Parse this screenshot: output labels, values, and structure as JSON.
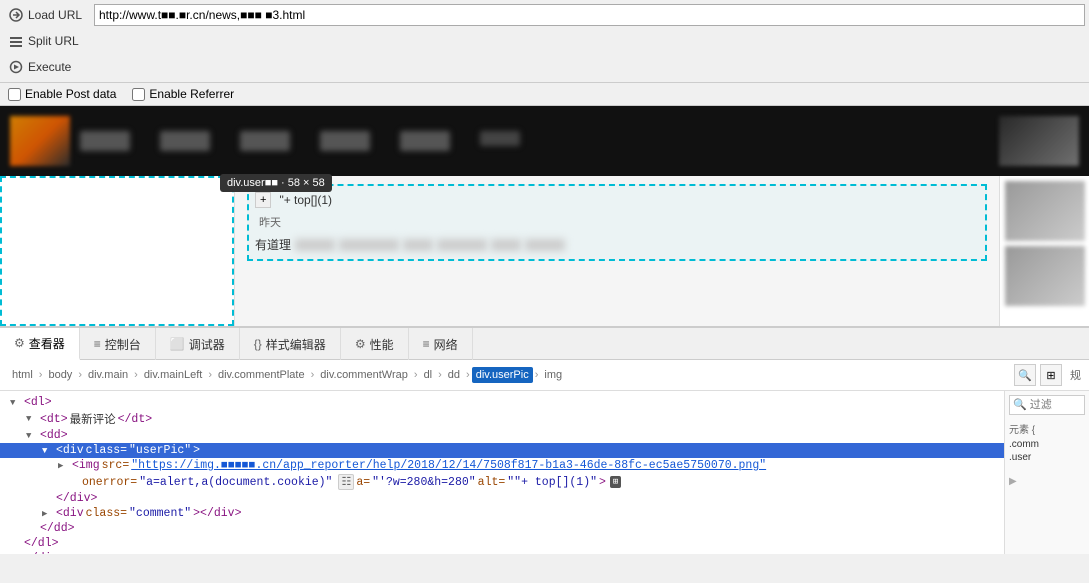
{
  "toolbar": {
    "load_url_label": "Load URL",
    "split_url_label": "Split URL",
    "execute_label": "Execute",
    "url_value": "http://www.t■■.■r.cn/news,■■■ ■3.html"
  },
  "checkboxes": {
    "post_data_label": "Enable Post data",
    "referrer_label": "Enable Referrer"
  },
  "breadcrumb": {
    "items": [
      "html",
      "body",
      "div.main",
      "div.mainLeft",
      "div.commentPlate",
      "div.commentWrap",
      "dl",
      "dd",
      "div.userPic",
      "img"
    ]
  },
  "devtools": {
    "tabs": [
      {
        "id": "inspector",
        "icon": "⚙",
        "label": "查看器"
      },
      {
        "id": "console",
        "icon": "≡",
        "label": "控制台"
      },
      {
        "id": "debugger",
        "icon": "⬛",
        "label": "调试器"
      },
      {
        "id": "style-editor",
        "icon": "{}",
        "label": "样式编辑器"
      },
      {
        "id": "performance",
        "icon": "⚙",
        "label": "性能"
      },
      {
        "id": "network",
        "icon": "≡",
        "label": "网络"
      }
    ]
  },
  "html_tree": {
    "lines": [
      {
        "indent": 0,
        "has_triangle": true,
        "triangle_open": true,
        "content": "<dl>"
      },
      {
        "indent": 1,
        "has_triangle": true,
        "triangle_open": true,
        "content": "<dt>最新评论</dt>"
      },
      {
        "indent": 1,
        "has_triangle": true,
        "triangle_open": true,
        "content": "<dd>"
      },
      {
        "indent": 2,
        "has_triangle": true,
        "triangle_open": true,
        "content": "<div class=\"userPic\">"
      },
      {
        "indent": 3,
        "has_triangle": true,
        "triangle_open": false,
        "content_parts": true,
        "tag": "img",
        "attrs": [
          {
            "name": "src",
            "value": "https://img.■■■■■.cn/app_reporter/help/2018/12/14/7508f817-b1a3-46de-88fc-ec5ae5750070.png",
            "is_link": true
          },
          {
            "name": "onerror",
            "value": "a=alert,a(document.cookie)"
          },
          {
            "name": "a",
            "value": "'?w=280&h=280'"
          },
          {
            "name": "alt",
            "value": "\"\"+ top[](1)"
          }
        ]
      },
      {
        "indent": 3,
        "is_image_badge": true
      },
      {
        "indent": 2,
        "is_close": true,
        "content": "</div>"
      },
      {
        "indent": 2,
        "has_triangle": true,
        "triangle_open": false,
        "content": "<div class=\"comment\"></div>"
      },
      {
        "indent": 1,
        "is_close": true,
        "content": "</dd>"
      },
      {
        "indent": 0,
        "is_close": true,
        "content": "</dl>"
      },
      {
        "indent": 0,
        "is_close": true,
        "content": "</div>"
      }
    ]
  },
  "webpage": {
    "tooltip_text": "div.user■■ · 58 × 58",
    "content_plus": "+",
    "content_top": "\"+ top[](1)",
    "content_date": "昨天",
    "content_youdaoli": "有道理",
    "blurred_text_lengths": [
      40,
      60,
      30,
      50,
      30,
      40
    ]
  },
  "right_panel": {
    "search_placeholder": "🔍",
    "label1": "元素 {",
    "rules": [
      ".comm",
      ".user"
    ]
  }
}
